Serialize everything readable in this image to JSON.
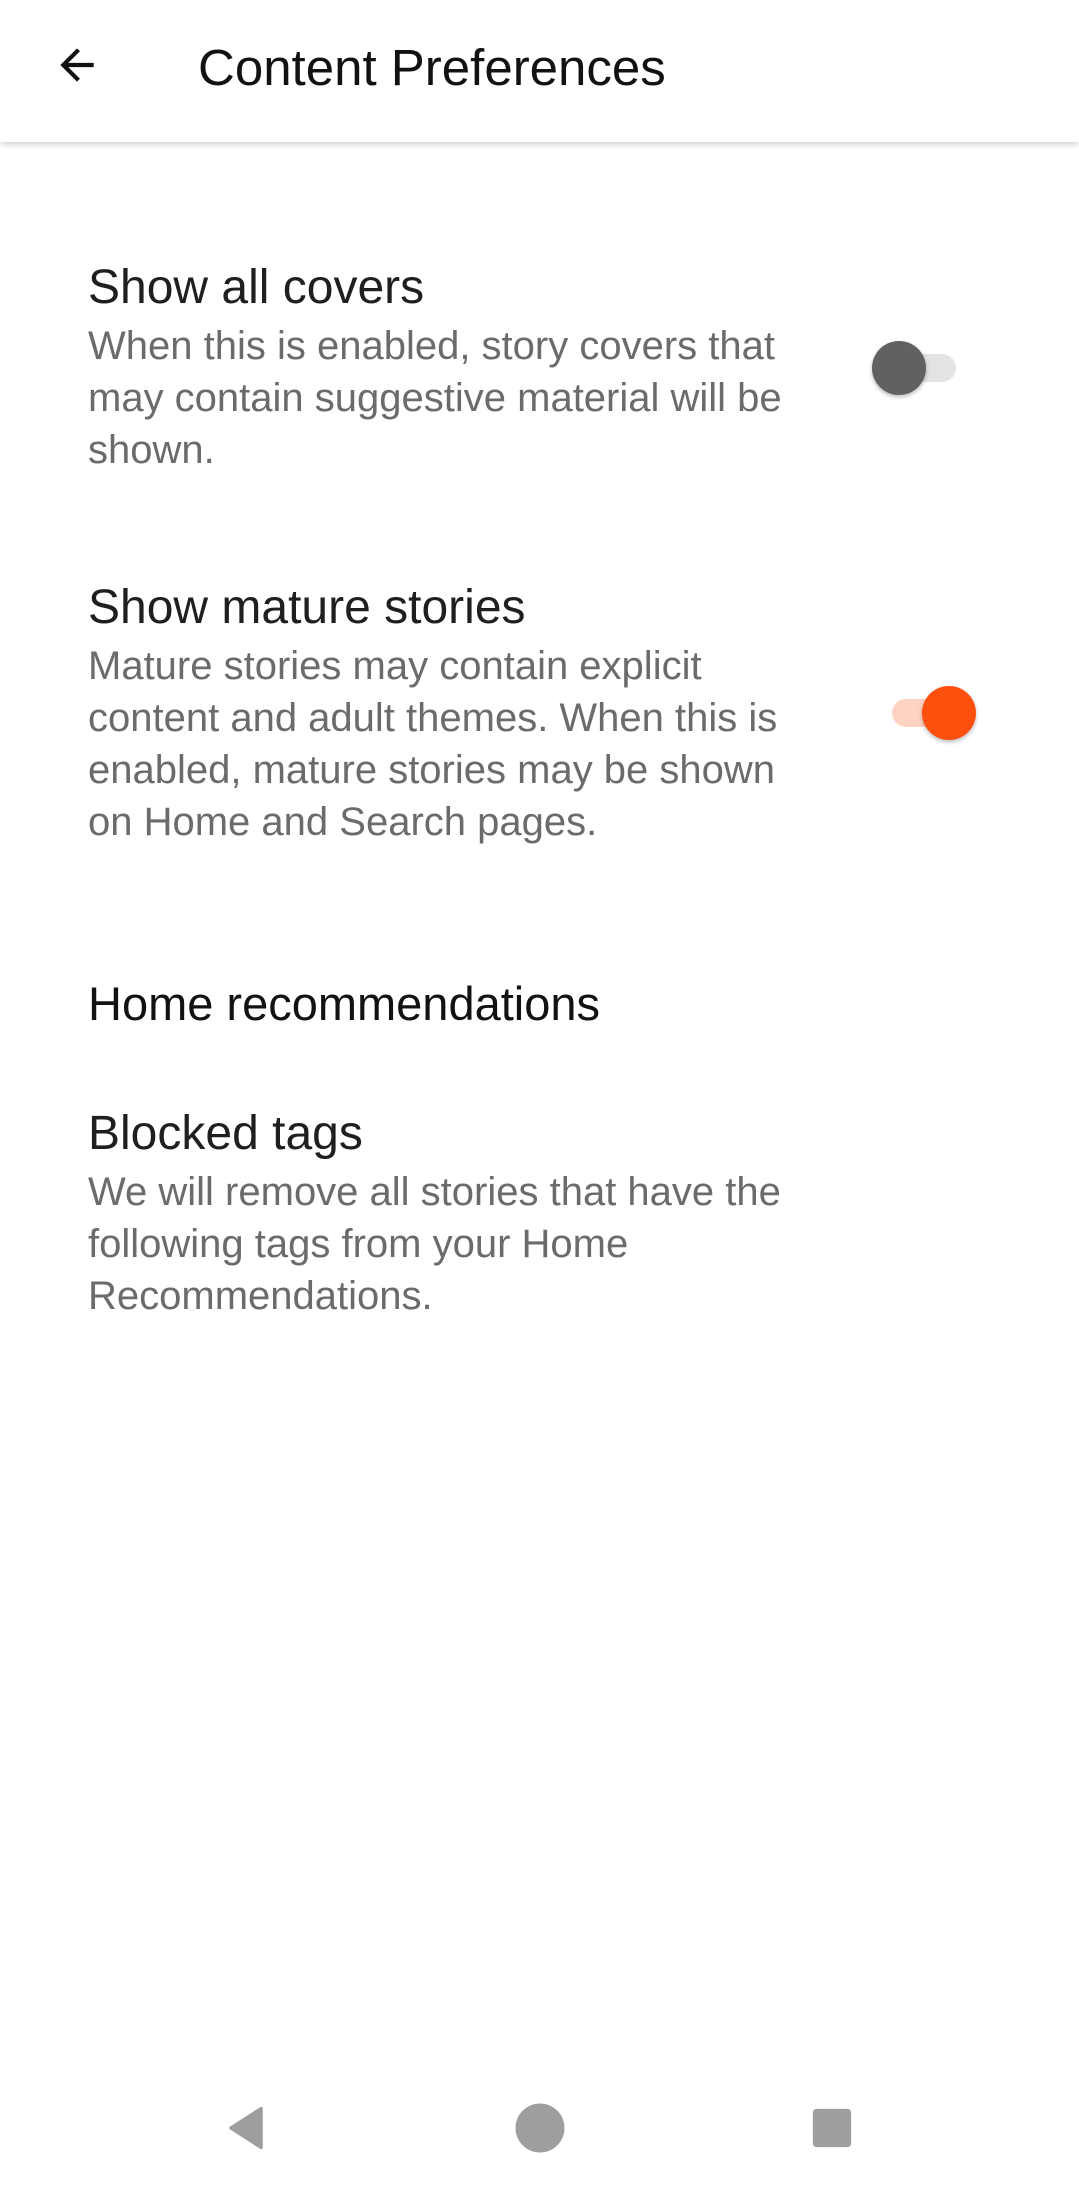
{
  "appbar": {
    "title": "Content Preferences",
    "back_icon": "arrow-left-icon"
  },
  "preferences": [
    {
      "title": "Show all covers",
      "summary": "When this is enabled, story covers that may contain suggestive material will be shown.",
      "enabled": false
    },
    {
      "title": "Show mature stories",
      "summary": "Mature stories may contain explicit content and adult themes. When this is enabled, mature stories may be shown on Home and Search pages.",
      "enabled": true
    }
  ],
  "home_recommendations": {
    "header": "Home recommendations",
    "blocked_tags": {
      "title": "Blocked tags",
      "summary": "We will remove all stories that have the following tags from your Home Recommendations."
    }
  },
  "navbar": {
    "back_icon": "triangle-back-icon",
    "home_icon": "circle-home-icon",
    "recents_icon": "square-recents-icon"
  },
  "colors": {
    "accent": "#ff4f0f",
    "accent_track": "#ffd3c2",
    "switch_off_thumb": "#616161",
    "switch_off_track": "#e3e3e3",
    "nav_icon": "#9e9e9e"
  }
}
